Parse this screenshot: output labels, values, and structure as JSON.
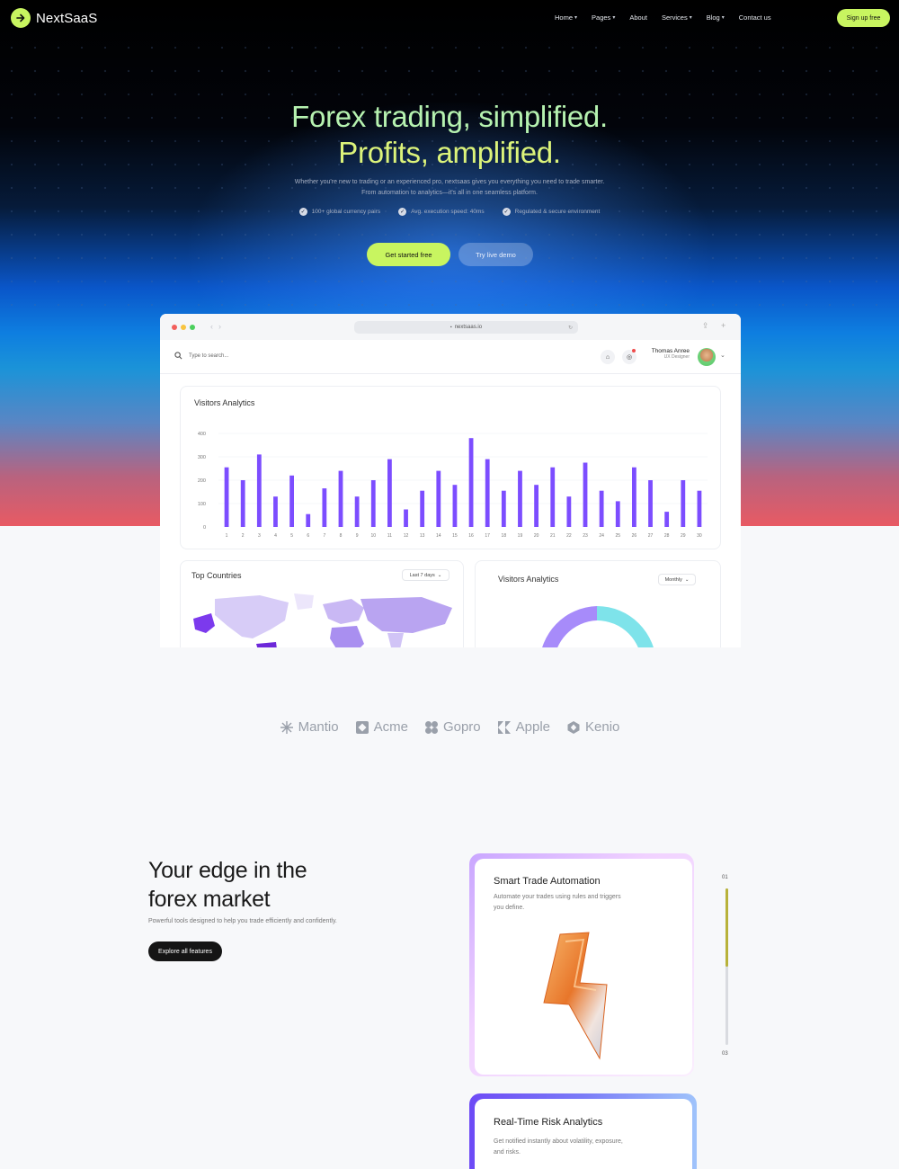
{
  "nav": {
    "brand": "NextSaaS",
    "links": [
      {
        "label": "Home",
        "caret": true
      },
      {
        "label": "Pages",
        "caret": true
      },
      {
        "label": "About",
        "caret": false
      },
      {
        "label": "Services",
        "caret": true
      },
      {
        "label": "Blog",
        "caret": true
      },
      {
        "label": "Contact us",
        "caret": false
      }
    ],
    "signup": "Sign up free"
  },
  "hero": {
    "title_line1": "Forex trading, simplified.",
    "title_line2": "Profits, amplified.",
    "subtitle": "Whether you're new to trading or an experienced pro, nextsaas gives you everything you need to trade smarter. From automation to analytics—it's all in one seamless platform.",
    "features": [
      "100+ global currency pairs",
      "Avg. execution speed: 40ms",
      "Regulated & secure environment"
    ],
    "cta_primary": "Get started free",
    "cta_secondary": "Try live demo"
  },
  "browser": {
    "url": "nextsaas.io",
    "search_placeholder": "Type to search...",
    "user_name": "Thomas Anree",
    "user_role": "UX Designer"
  },
  "colors": {
    "accent": "#c8f560",
    "bar": "#7c4dff",
    "donut_purple": "#a78bfa",
    "donut_cyan": "#7ee3ea"
  },
  "chart_data": {
    "type": "bar",
    "title": "Visitors Analytics",
    "categories": [
      "1",
      "2",
      "3",
      "4",
      "5",
      "6",
      "7",
      "8",
      "9",
      "10",
      "11",
      "12",
      "13",
      "14",
      "15",
      "16",
      "17",
      "18",
      "19",
      "20",
      "21",
      "22",
      "23",
      "24",
      "25",
      "26",
      "27",
      "28",
      "29",
      "30"
    ],
    "values": [
      255,
      200,
      310,
      130,
      220,
      55,
      165,
      240,
      130,
      200,
      290,
      75,
      155,
      240,
      180,
      380,
      290,
      155,
      240,
      180,
      255,
      130,
      275,
      155,
      110,
      255,
      200,
      65,
      200,
      155
    ],
    "yticks": [
      "0",
      "100",
      "200",
      "300",
      "400"
    ],
    "ylim": [
      0,
      400
    ],
    "grid": true
  },
  "top_countries": {
    "title": "Top Countries",
    "filter": "Last 7 days"
  },
  "visitors_donut": {
    "title": "Visitors Analytics",
    "filter": "Monthly"
  },
  "logos": [
    {
      "name": "Mantio",
      "icon": "sunburst-icon"
    },
    {
      "name": "Acme",
      "icon": "square-diamond-icon"
    },
    {
      "name": "Gopro",
      "icon": "clover-icon"
    },
    {
      "name": "Apple",
      "icon": "k-shape-icon"
    },
    {
      "name": "Kenio",
      "icon": "hexagon-icon"
    }
  ],
  "features_section": {
    "title_line1": "Your edge in the",
    "title_line2": "forex market",
    "subtitle": "Powerful tools designed to help you trade efficiently and confidently.",
    "button": "Explore all features",
    "cards": [
      {
        "title": "Smart Trade Automation",
        "desc": "Automate your trades using rules and triggers you define."
      },
      {
        "title": "Real-Time Risk Analytics",
        "desc": "Get notified instantly about volatility, exposure, and risks."
      }
    ],
    "progress": {
      "start": "01",
      "end": "03",
      "value": 0.5
    }
  }
}
